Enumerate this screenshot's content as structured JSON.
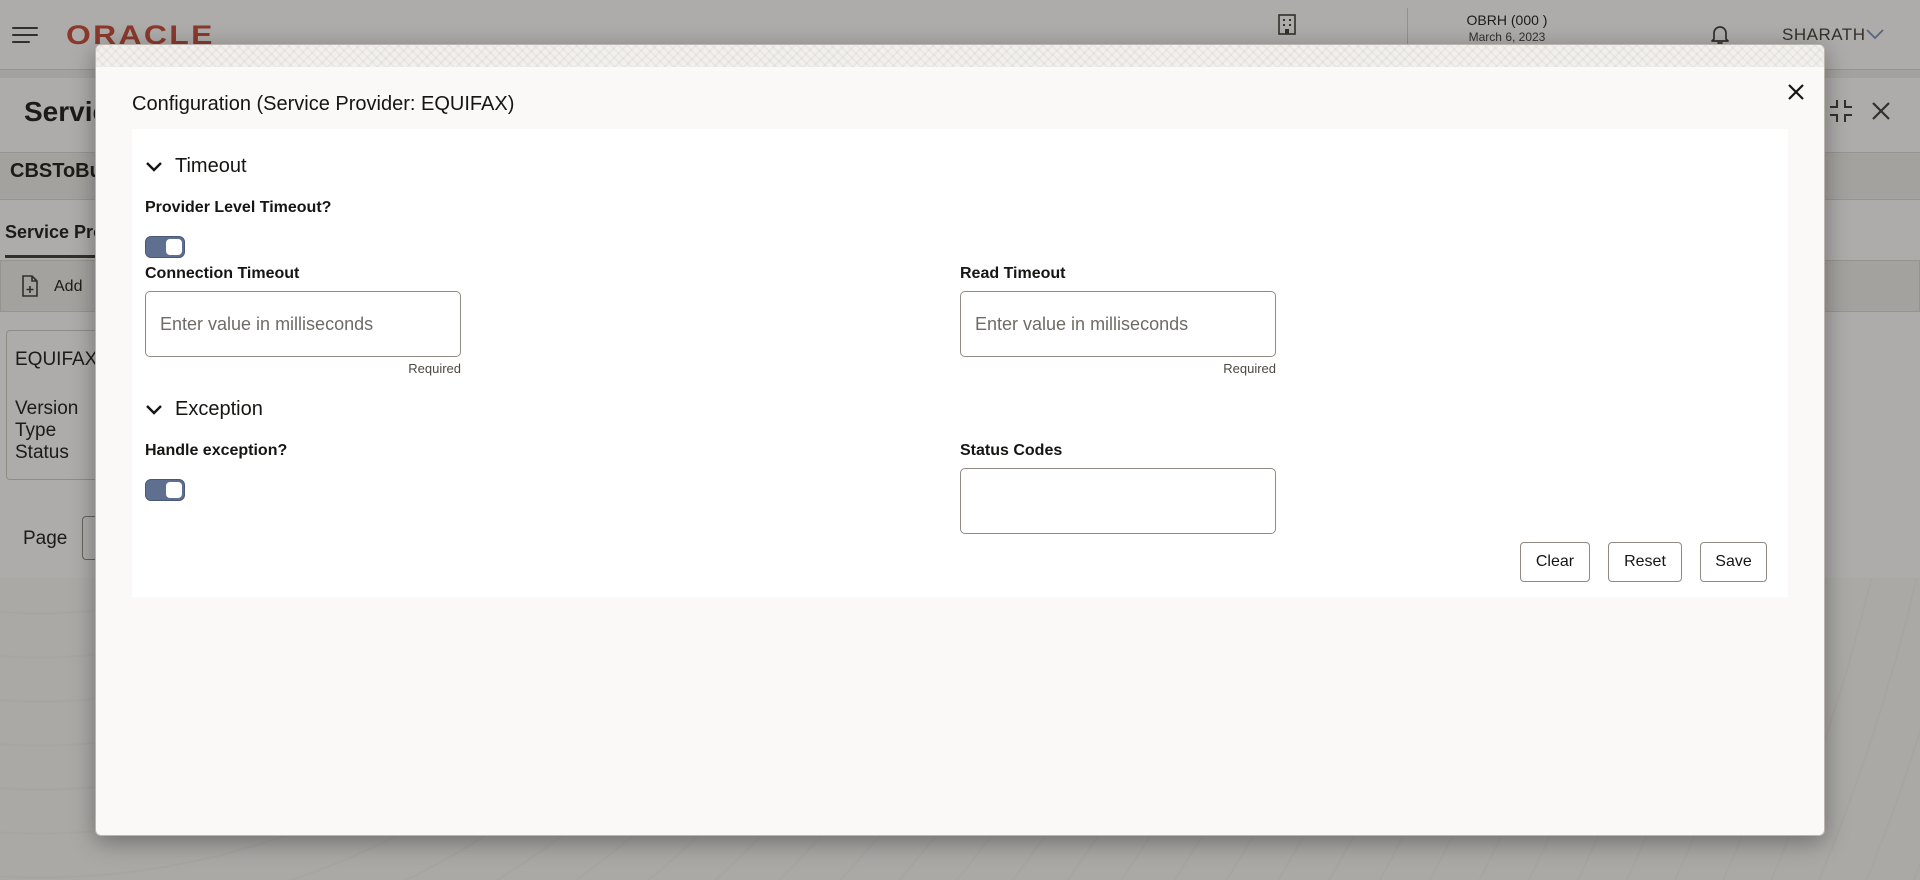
{
  "header": {
    "logo": "ORACLE",
    "branch_code": "OBRH  (000 )",
    "branch_date": "March 6, 2023",
    "user": "SHARATH"
  },
  "background": {
    "title": "Servic",
    "strip_text": "CBSToBu",
    "tab_label": "Service Pro",
    "add_label": "Add",
    "card_title": "EQUIFAX",
    "card_fields": [
      "Version",
      "Type",
      "Status"
    ],
    "page_label": "Page"
  },
  "dialog": {
    "title": "Configuration (Service Provider: EQUIFAX)",
    "sections": {
      "timeout": {
        "heading": "Timeout",
        "provider_level_label": "Provider Level Timeout?",
        "provider_level_on": true,
        "connection": {
          "label": "Connection Timeout",
          "value": "",
          "placeholder": "Enter value in milliseconds",
          "helper": "Required"
        },
        "read": {
          "label": "Read Timeout",
          "value": "",
          "placeholder": "Enter value in milliseconds",
          "helper": "Required"
        }
      },
      "exception": {
        "heading": "Exception",
        "handle_label": "Handle exception?",
        "handle_on": true,
        "status_codes": {
          "label": "Status Codes",
          "value": ""
        }
      }
    },
    "buttons": {
      "clear": "Clear",
      "reset": "Reset",
      "save": "Save"
    }
  }
}
